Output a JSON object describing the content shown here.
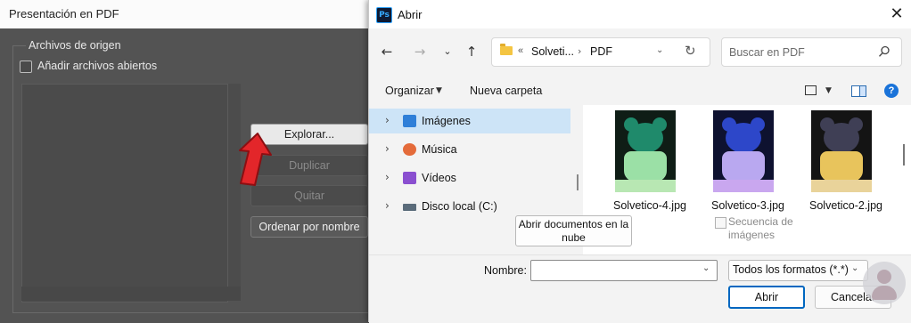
{
  "ps_dialog": {
    "title": "Presentación en PDF",
    "group_label": "Archivos de origen",
    "add_open_files_label": "Añadir archivos abiertos",
    "buttons": {
      "explore": "Explorar...",
      "duplicate": "Duplicar",
      "remove": "Quitar",
      "sort": "Ordenar por nombre"
    }
  },
  "open_dialog": {
    "app_icon_text": "Ps",
    "title": "Abrir",
    "close_glyph": "✕",
    "nav": {
      "back": "←",
      "forward": "→",
      "recent": "⌄",
      "up": "↑",
      "refresh": "↻"
    },
    "address": {
      "overflow": "«",
      "segment1": "Solveti...",
      "separator": "›",
      "segment2": "PDF",
      "dropdown": "⌄"
    },
    "search_placeholder": "Buscar en PDF",
    "toolbar": {
      "organize": "Organizar",
      "organize_dd": "▼",
      "new_folder": "Nueva carpeta",
      "view_dd": "▼",
      "help": "?"
    },
    "tree": [
      {
        "label": "Imágenes",
        "icon": "pictures-icon",
        "color": "#2f7fd8",
        "selected": true
      },
      {
        "label": "Música",
        "icon": "music-icon",
        "color": "#e46b3a",
        "selected": false
      },
      {
        "label": "Vídeos",
        "icon": "videos-icon",
        "color": "#8a4fd0",
        "selected": false
      },
      {
        "label": "Disco local (C:)",
        "icon": "drive-icon",
        "color": "#4a4a4a",
        "selected": false
      }
    ],
    "tree_chevron": "›",
    "files": [
      {
        "name": "Solvetico-4.jpg",
        "tint": "#1f8a6b",
        "shirt": "#9be0a6",
        "base": "#b8e7b3"
      },
      {
        "name": "Solvetico-3.jpg",
        "tint": "#2d47c9",
        "shirt": "#b9a8f0",
        "base": "#c9a7ef"
      },
      {
        "name": "Solvetico-2.jpg",
        "tint": "#3f3f55",
        "shirt": "#e8c45c",
        "base": "#e9d39a"
      }
    ],
    "cloud_button": "Abrir documentos en la nube",
    "image_sequence_label": "Secuencia de imágenes",
    "name_label": "Nombre:",
    "name_value": "",
    "file_type": "Todos los formatos (*.*)",
    "dropdown_glyph": "⌄",
    "open_button": "Abrir",
    "cancel_button": "Cancelar"
  }
}
